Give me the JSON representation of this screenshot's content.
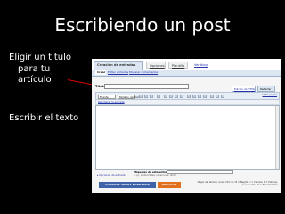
{
  "slide": {
    "title": "Escribiendo un post",
    "label1": [
      "Eligir un titulo",
      "para tu",
      "artículo"
    ],
    "label2": "Escribir el texto",
    "arrow_color": "#e00000"
  },
  "screenshot": {
    "tabs": [
      "Creación de entradas",
      "Opciones",
      "Plantilla",
      "Ver blog"
    ],
    "subtabs": [
      "Crear",
      "Editar entradas",
      "Moderar comentarios"
    ],
    "title_label": "Título:",
    "font_select": "Fuente",
    "size_select": "Tamaño normal",
    "edit_tabs": [
      "Edición de HTML",
      "Redactar"
    ],
    "preview_link": "Vista previa",
    "link_bar": "Recuperar la entrada",
    "tags_label": "Etiquetas de esta entrada:",
    "tags_example": "p. ej., motocicletas, vacaciones, otoño",
    "options_link": "▸ Opciones de entrada",
    "save_button": "GUARDAR AHORA  BORRADOR",
    "publish_button": "PUBLICAR",
    "shortcuts_hint": [
      "Atajos del teclado: pulse Ctrl con: B = Negrita, I = Cursiva, P = Publicar,",
      "S = Guardar, D = Borrador más"
    ]
  }
}
